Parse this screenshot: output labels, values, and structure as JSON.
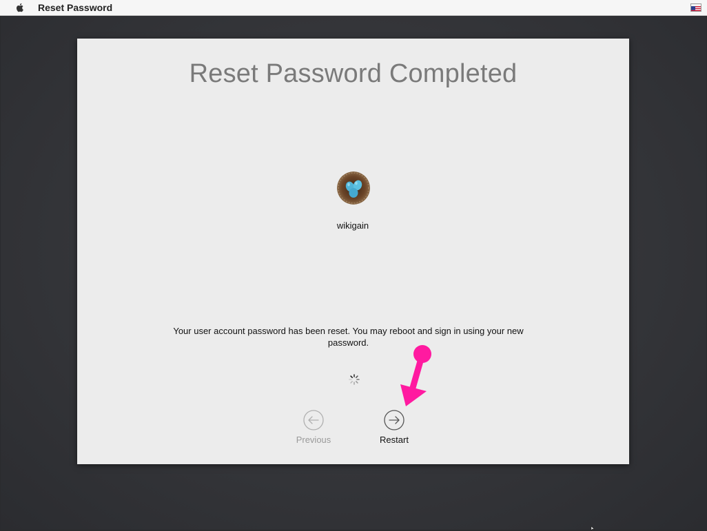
{
  "menubar": {
    "app_name": "Reset Password",
    "apple_icon": "apple-logo-icon",
    "flag_icon": "us-flag-icon"
  },
  "panel": {
    "title": "Reset Password Completed",
    "username": "wikigain",
    "message": "Your user account password has been reset. You may reboot and sign in using your new password."
  },
  "buttons": {
    "previous_label": "Previous",
    "restart_label": "Restart"
  },
  "colors": {
    "annotation": "#ff1aa0",
    "title": "#7a7a7a",
    "panel_bg": "#ececec",
    "desktop_bg": "#36373b"
  }
}
